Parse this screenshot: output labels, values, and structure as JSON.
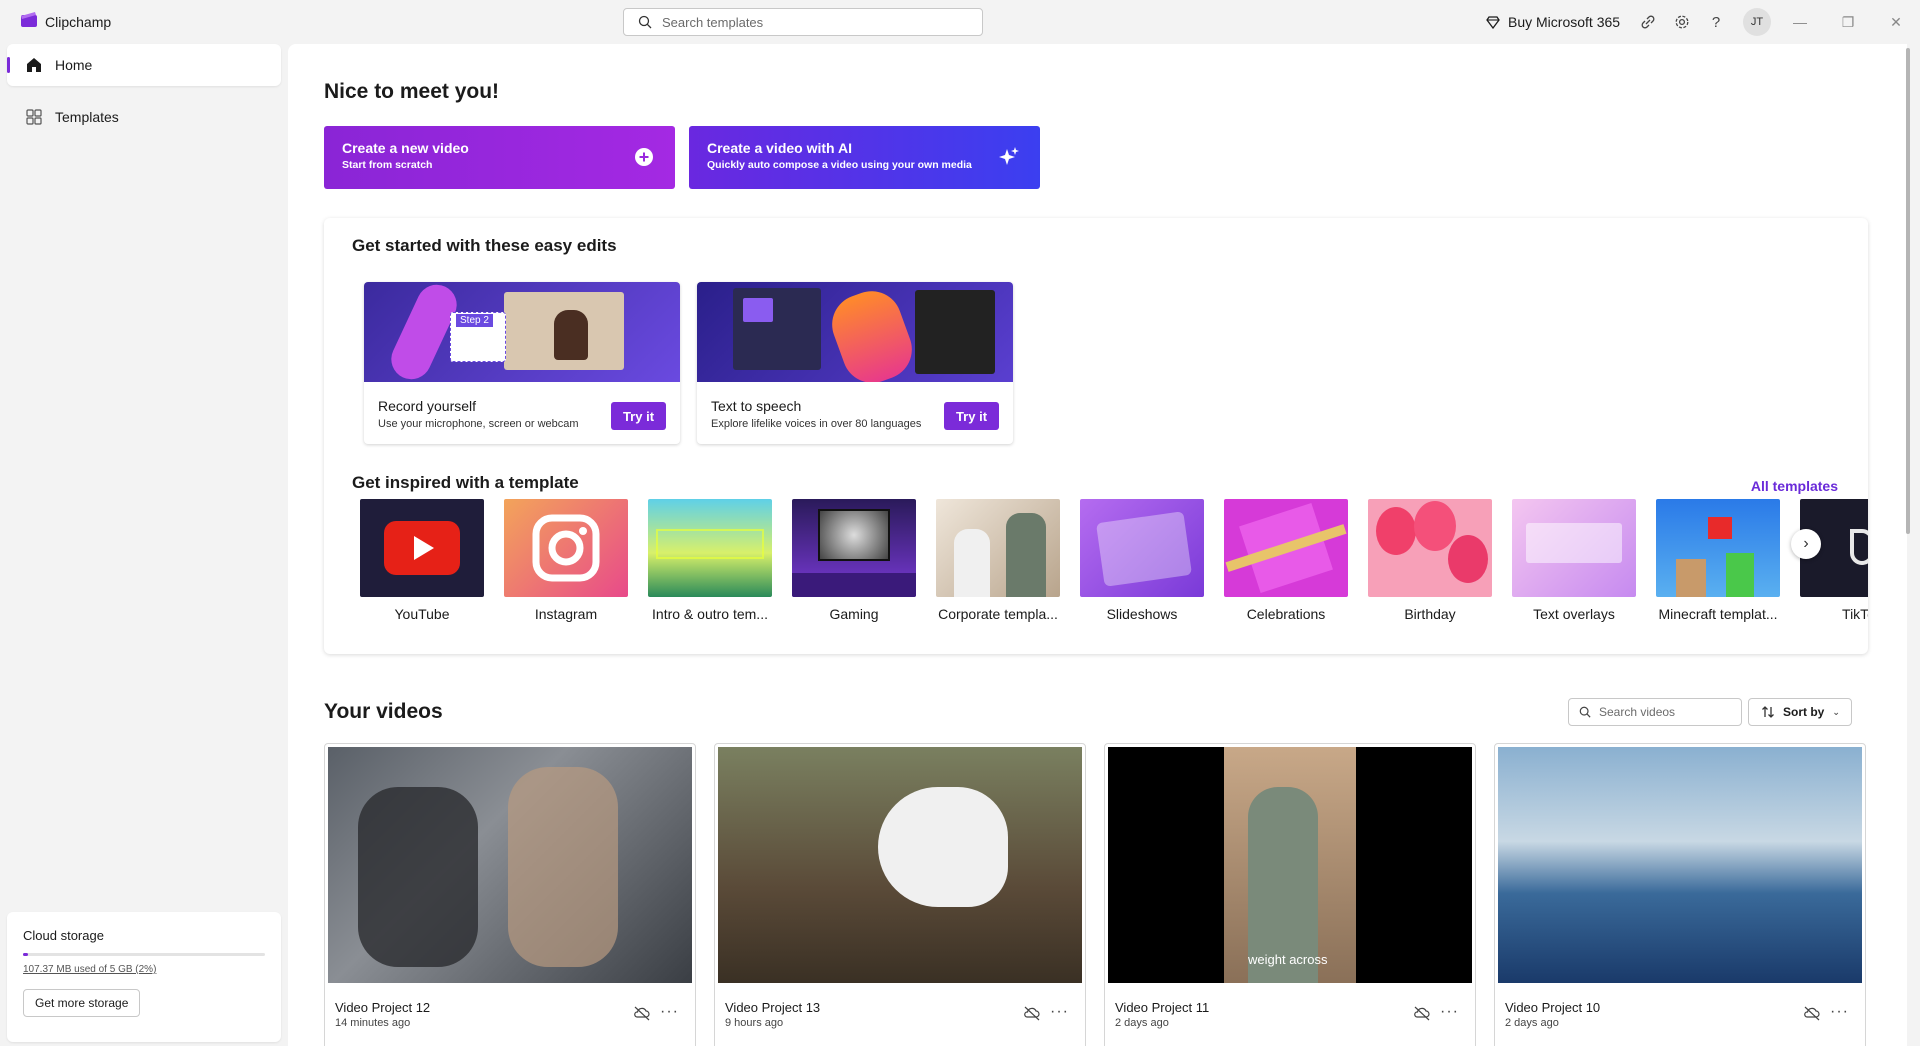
{
  "app": {
    "title": "Clipchamp"
  },
  "search": {
    "placeholder": "Search templates"
  },
  "titlebar": {
    "buy_label": "Buy Microsoft 365",
    "avatar_initials": "JT"
  },
  "sidebar": {
    "items": [
      {
        "label": "Home",
        "icon": "home-icon",
        "active": true
      },
      {
        "label": "Templates",
        "icon": "templates-icon",
        "active": false
      }
    ],
    "storage": {
      "title": "Cloud storage",
      "usage_text": "107.37 MB used of 5 GB (2%)",
      "usage_percent": 2,
      "button_label": "Get more storage"
    }
  },
  "main": {
    "greeting": "Nice to meet you!",
    "cta": [
      {
        "title": "Create a new video",
        "subtitle": "Start from scratch",
        "icon": "plus-circle-icon"
      },
      {
        "title": "Create a video with AI",
        "subtitle": "Quickly auto compose a video using your own media",
        "icon": "sparkle-icon"
      }
    ],
    "easy_edits": {
      "heading": "Get started with these easy edits",
      "cards": [
        {
          "title": "Record yourself",
          "subtitle": "Use your microphone, screen or webcam",
          "button": "Try it",
          "thumb_text": "Step 2"
        },
        {
          "title": "Text to speech",
          "subtitle": "Explore lifelike voices in over 80 languages",
          "button": "Try it"
        }
      ]
    },
    "templates": {
      "heading": "Get inspired with a template",
      "all_label": "All templates",
      "items": [
        {
          "label": "YouTube"
        },
        {
          "label": "Instagram"
        },
        {
          "label": "Intro & outro tem..."
        },
        {
          "label": "Gaming"
        },
        {
          "label": "Corporate templa..."
        },
        {
          "label": "Slideshows"
        },
        {
          "label": "Celebrations"
        },
        {
          "label": "Birthday"
        },
        {
          "label": "Text overlays"
        },
        {
          "label": "Minecraft templat..."
        },
        {
          "label": "TikTok"
        }
      ]
    },
    "videos": {
      "heading": "Your videos",
      "search_placeholder": "Search videos",
      "sort_label": "Sort by",
      "items": [
        {
          "title": "Video Project 12",
          "time": "14 minutes ago"
        },
        {
          "title": "Video Project 13",
          "time": "9 hours ago"
        },
        {
          "title": "Video Project 11",
          "time": "2 days ago",
          "caption": "weight across"
        },
        {
          "title": "Video Project 10",
          "time": "2 days ago"
        }
      ]
    }
  },
  "colors": {
    "accent": "#7b2bd9",
    "cta_ai": "#3b3ff0"
  }
}
